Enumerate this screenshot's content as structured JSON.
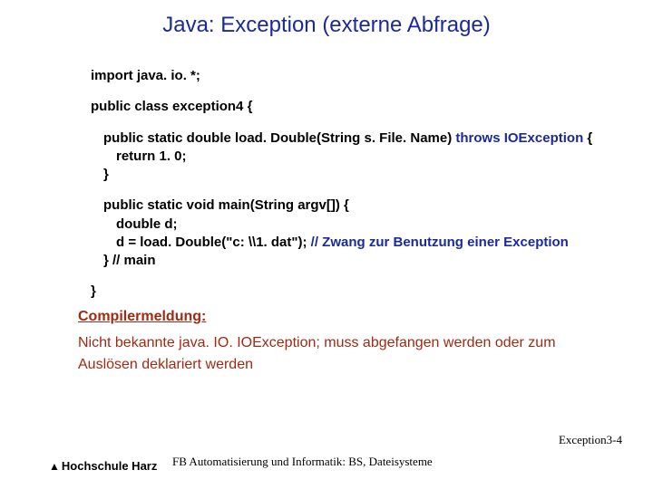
{
  "title": "Java: Exception (externe Abfrage)",
  "code": {
    "import": "import java. io. *;",
    "class_decl": "public class exception4 {",
    "m1_sig_pre": "public static double load. Double(String s. File. Name)",
    "m1_sig_throws": " throws IOException ",
    "m1_sig_post": "{",
    "m1_body": "return 1. 0;",
    "m1_close": "}",
    "m2_sig": "public static void main(String argv[]) {",
    "m2_l1": "double d;",
    "m2_l2_pre": "d = load. Double(\"c: \\\\1. dat\");  ",
    "m2_l2_comment": "// Zwang zur Benutzung einer Exception",
    "m2_close": "}  // main",
    "class_close": "}"
  },
  "compiler": {
    "label": "Compilermeldung:",
    "msg1": "Nicht bekannte java. IO. IOException; muss abgefangen werden oder zum",
    "msg2": "Auslösen deklariert werden"
  },
  "pagenum": "Exception3-4",
  "footer": "FB Automatisierung und Informatik: BS, Dateisysteme",
  "logo": "Hochschule Harz"
}
